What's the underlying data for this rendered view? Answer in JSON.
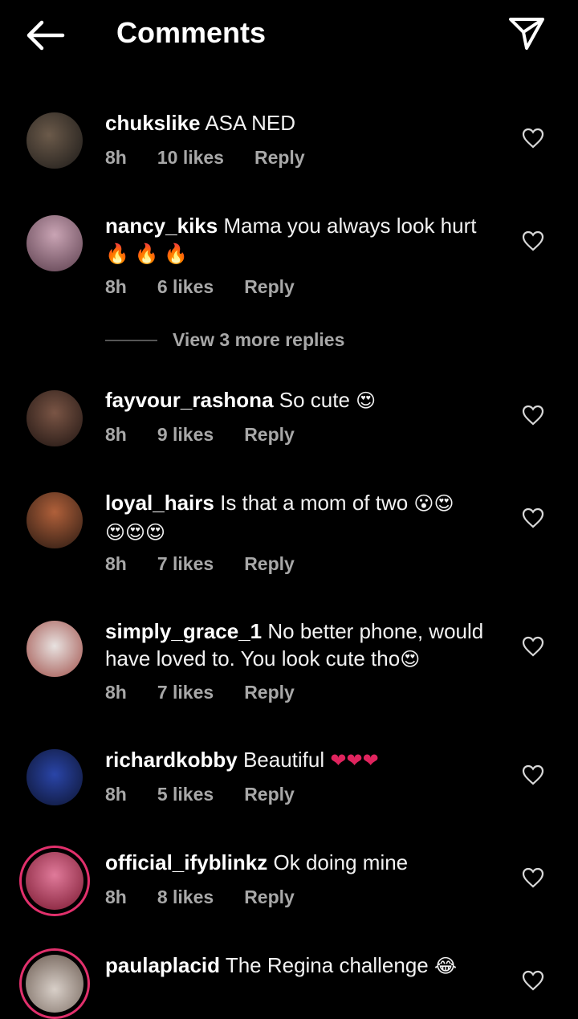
{
  "header": {
    "title": "Comments",
    "back_icon": "arrow-left-icon",
    "share_icon": "paper-plane-icon"
  },
  "comments": [
    {
      "username": "chukslike",
      "text": "ASA NED",
      "time": "8h",
      "likes": "10 likes",
      "reply": "Reply"
    },
    {
      "username": "nancy_kiks",
      "text": "Mama you always look hurt",
      "emoji": "🔥 🔥 🔥",
      "time": "8h",
      "likes": "6 likes",
      "reply": "Reply"
    },
    {
      "username": "fayvour_rashona",
      "text": "So cute",
      "emoji": "😍",
      "time": "8h",
      "likes": "9 likes",
      "reply": "Reply"
    },
    {
      "username": "loyal_hairs",
      "text": "Is that a mom of two",
      "emoji": "😮😍",
      "emoji2": "😍😍😍",
      "time": "8h",
      "likes": "7 likes",
      "reply": "Reply"
    },
    {
      "username": "simply_grace_1",
      "text": "No better phone, would have loved to. You look cute tho",
      "emoji": "😍",
      "time": "8h",
      "likes": "7 likes",
      "reply": "Reply"
    },
    {
      "username": "richardkobby",
      "text": "Beautiful",
      "emoji": "❤❤❤",
      "time": "8h",
      "likes": "5 likes",
      "reply": "Reply"
    },
    {
      "username": "official_ifyblinkz",
      "text": "Ok doing mine",
      "time": "8h",
      "likes": "8 likes",
      "reply": "Reply"
    },
    {
      "username": "paulaplacid",
      "text": "The Regina challenge",
      "emoji": "😂"
    }
  ],
  "view_more_replies": "View 3 more replies",
  "colors": {
    "background": "#000000",
    "text": "#f5f5f5",
    "meta": "#a8a8a8",
    "story_ring": "#e1306c"
  }
}
